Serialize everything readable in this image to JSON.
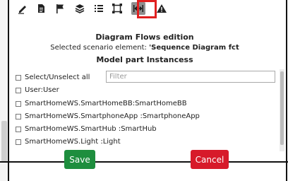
{
  "dialog": {
    "title": "Diagram Flows edition",
    "subtitle_prefix": "Selected scenario element: ",
    "subtitle_value": "'Sequence Diagram fct",
    "section_title": "Model part Instancess"
  },
  "select_all_label": "Select/Unselect all",
  "filter": {
    "placeholder": "Filter",
    "value": ""
  },
  "items": [
    {
      "label": "User:User",
      "checked": false
    },
    {
      "label": "SmartHomeWS.SmartHomeBB:SmartHomeBB",
      "checked": false
    },
    {
      "label": "SmartHomeWS.SmartphoneApp :SmartphoneApp",
      "checked": false
    },
    {
      "label": "SmartHomeWS.SmartHub :SmartHub",
      "checked": false
    },
    {
      "label": "SmartHomeWS.Light :Light",
      "checked": false
    }
  ],
  "buttons": {
    "save": "Save",
    "cancel": "Cancel"
  },
  "toolbar": {
    "icons": [
      "pencil-icon",
      "document-icon",
      "flag-icon",
      "layers-icon",
      "list-icon",
      "frame-icon",
      "flow-icon",
      "warning-icon"
    ],
    "active": "flow-icon"
  },
  "colors": {
    "save": "#1e8e3e",
    "cancel": "#d71a2a",
    "highlight": "#e02020",
    "active_tool": "#8e8e8e"
  }
}
